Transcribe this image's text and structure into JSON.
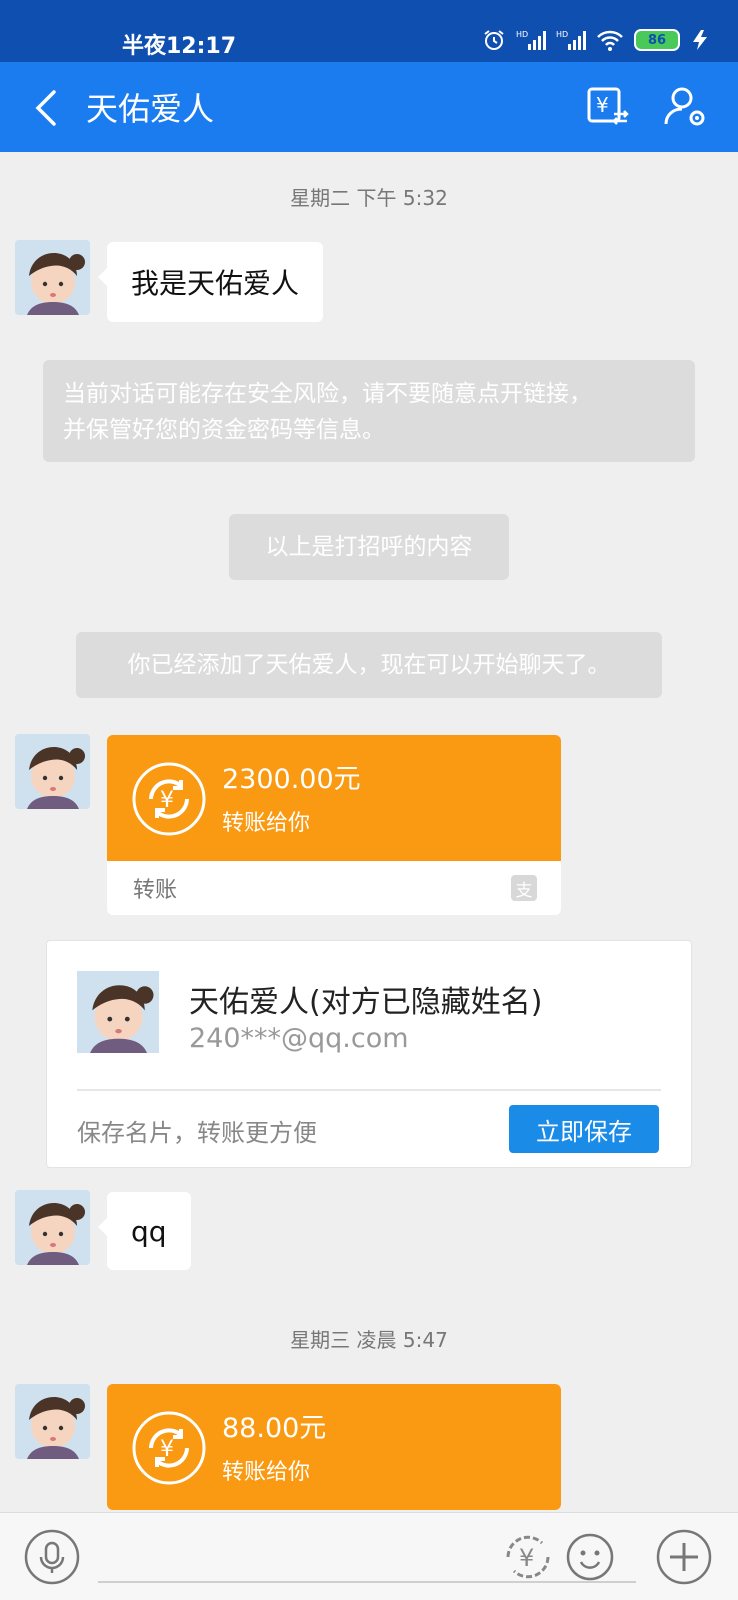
{
  "status_bar": {
    "time": "半夜12:17",
    "battery": "86",
    "icons": [
      "alarm-icon",
      "signal-hd-icon",
      "signal-hd-icon",
      "wifi-icon",
      "battery-icon",
      "charging-icon"
    ]
  },
  "header": {
    "title": "天佑爱人",
    "back_icon": "chevron-left-icon",
    "actions": [
      "transfer-icon",
      "profile-settings-icon"
    ]
  },
  "chat": {
    "timestamps": [
      "星期二 下午 5:32",
      "星期三 凌晨 5:47"
    ],
    "messages": {
      "greeting": "我是天佑爱人",
      "qq": "qq"
    },
    "notices": {
      "security_line1": "当前对话可能存在安全风险，请不要随意点开链接，",
      "security_line2": "并保管好您的资金密码等信息。",
      "greeting_notice": "以上是打招呼的内容",
      "added_notice": "你已经添加了天佑爱人，现在可以开始聊天了。"
    },
    "transfers": [
      {
        "amount": "2300.00元",
        "desc": "转账给你",
        "footer": "转账",
        "badge": "支"
      },
      {
        "amount": "88.00元",
        "desc": "转账给你"
      }
    ],
    "contact_card": {
      "name": "天佑爱人(对方已隐藏姓名)",
      "email": "240***@qq.com",
      "hint": "保存名片，转账更方便",
      "save_label": "立即保存"
    }
  },
  "colors": {
    "status_bar": "#0f4fb0",
    "header": "#1b7cf0",
    "transfer_orange": "#fa9a12",
    "save_button": "#1b8be8",
    "background": "#efefef"
  }
}
